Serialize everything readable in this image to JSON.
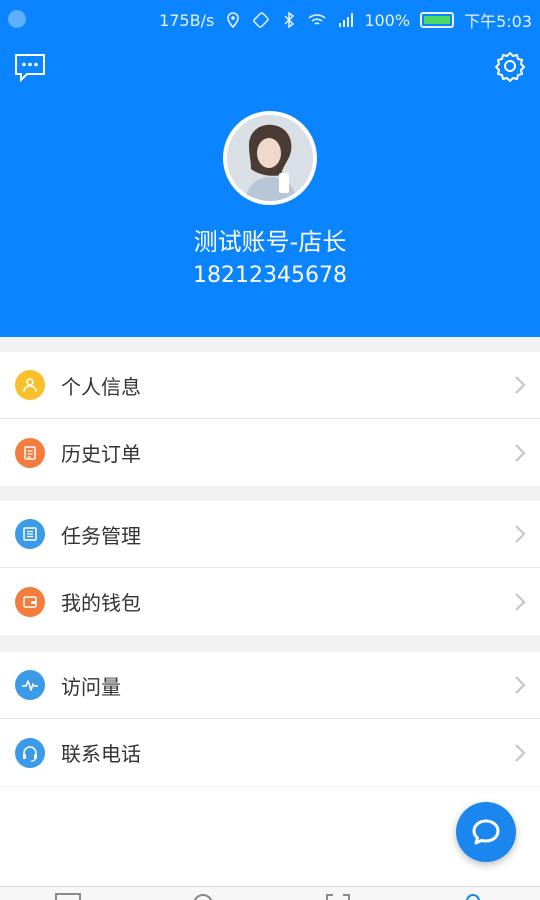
{
  "status_bar": {
    "speed": "175B/s",
    "battery": "100%",
    "time": "下午5:03",
    "icons": [
      "app-notification-icon",
      "location-icon",
      "rotate-icon",
      "bluetooth-icon",
      "wifi-icon",
      "cell-signal-icon",
      "battery-icon"
    ]
  },
  "profile": {
    "name": "测试账号-店长",
    "phone": "18212345678"
  },
  "menu": {
    "group1": [
      {
        "label": "个人信息",
        "icon": "person-icon",
        "color": "#f8c12c"
      },
      {
        "label": "历史订单",
        "icon": "order-list-icon",
        "color": "#f47c3c"
      }
    ],
    "group2": [
      {
        "label": "任务管理",
        "icon": "task-list-icon",
        "color": "#3b9be8"
      },
      {
        "label": "我的钱包",
        "icon": "wallet-icon",
        "color": "#f47c3c"
      }
    ],
    "group3": [
      {
        "label": "访问量",
        "icon": "pulse-icon",
        "color": "#3b9be8"
      },
      {
        "label": "联系电话",
        "icon": "headset-icon",
        "color": "#3b9be8"
      }
    ]
  },
  "colors": {
    "header_bg": "#0a84ff",
    "page_bg": "#f2f2f2",
    "fab": "#1a86ee"
  }
}
